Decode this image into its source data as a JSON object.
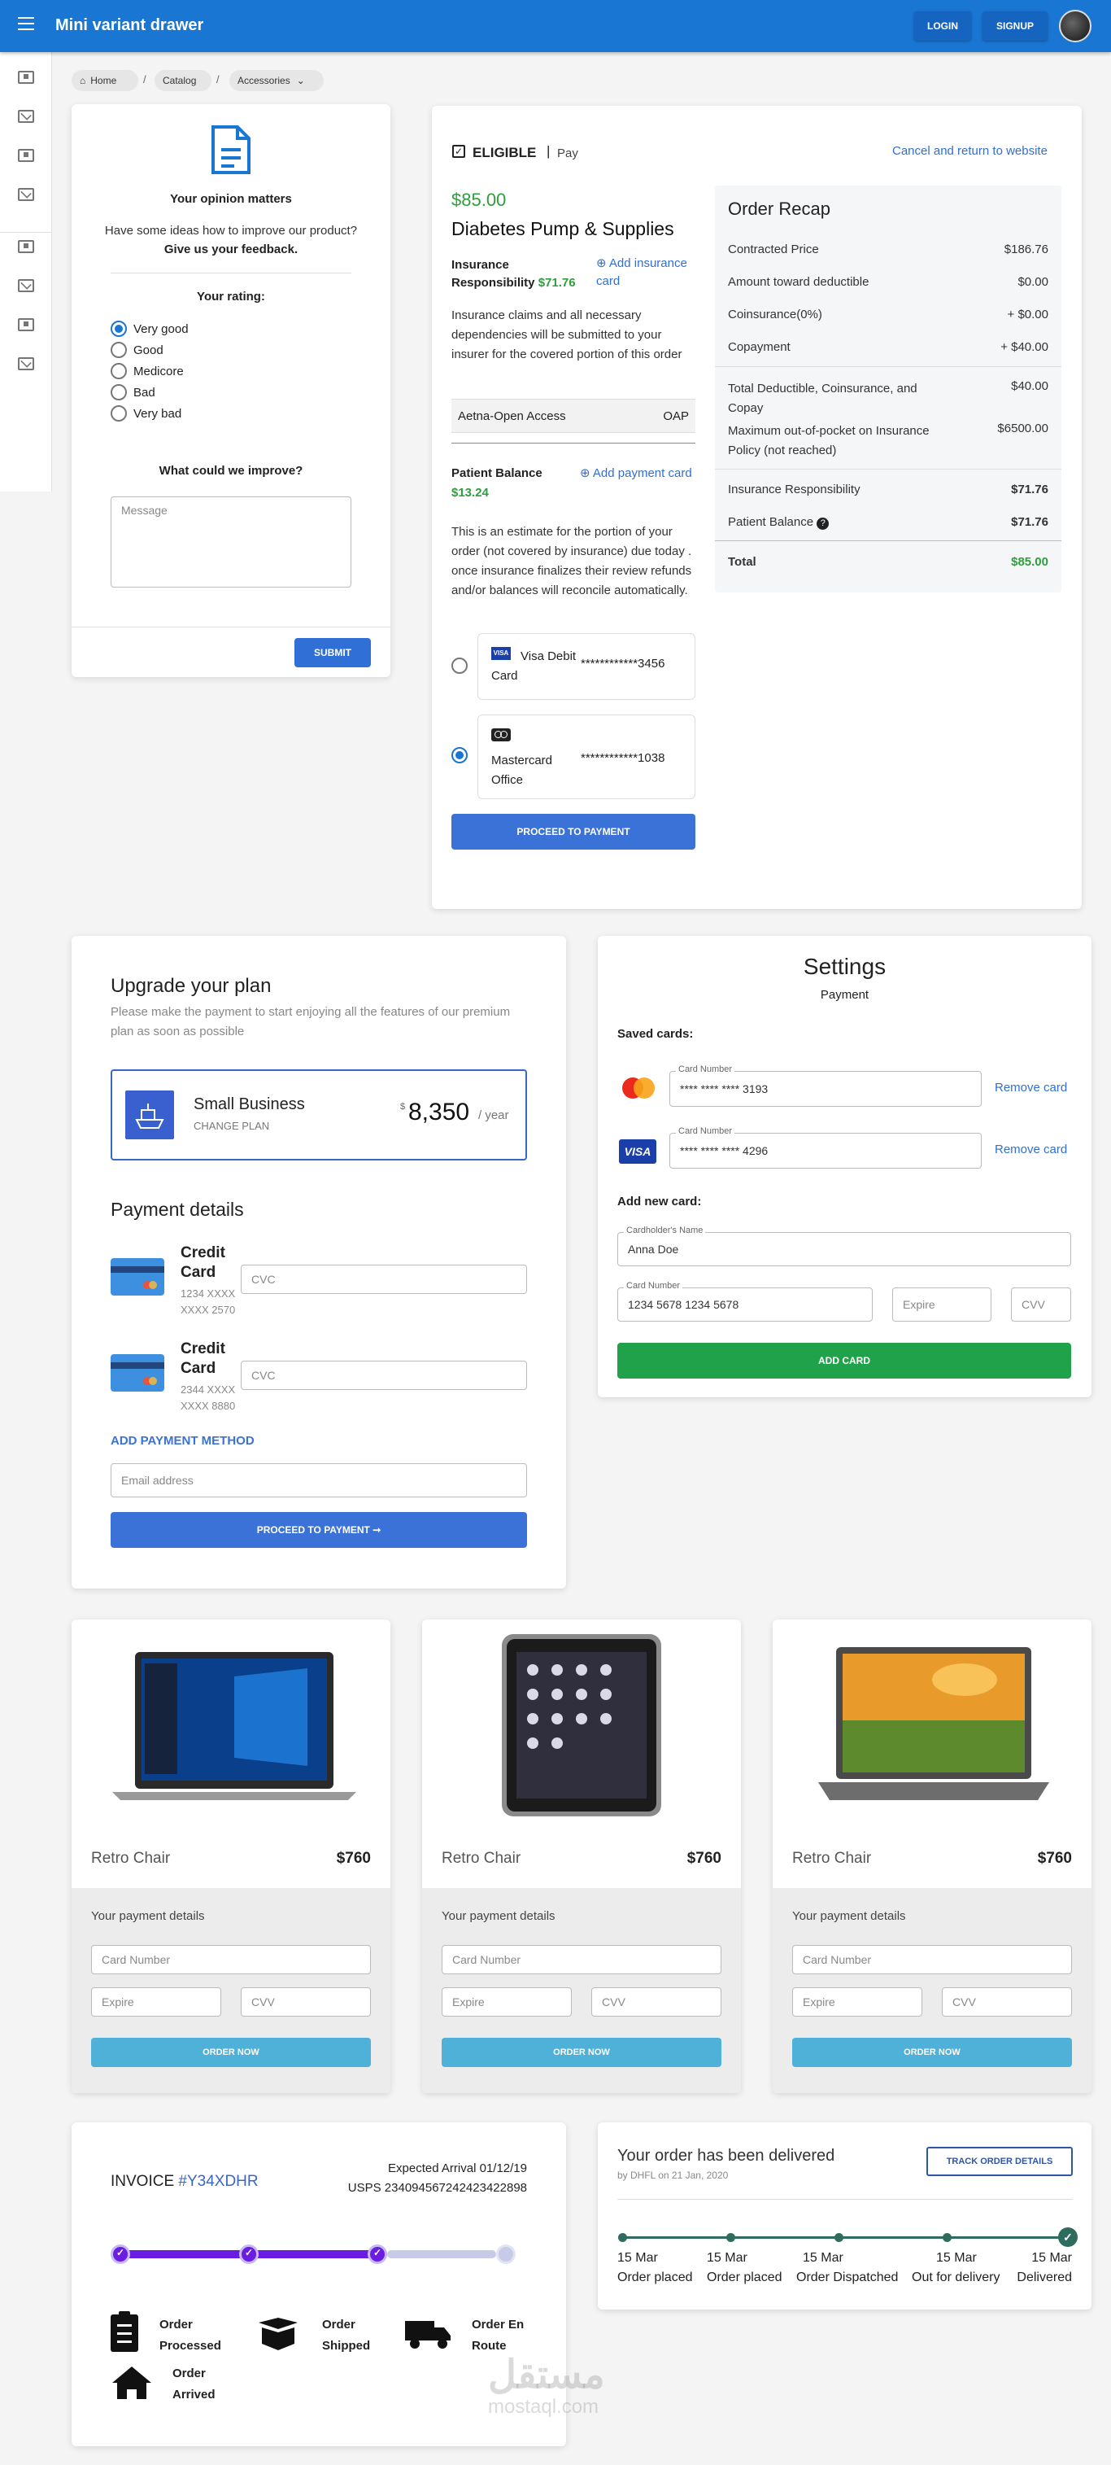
{
  "appbar": {
    "title": "Mini variant drawer",
    "login": "LOGIN",
    "signup": "SIGNUP"
  },
  "breadcrumb": {
    "home": "Home",
    "catalog": "Catalog",
    "accessories": "Accessories"
  },
  "feedback": {
    "title": "Your opinion matters",
    "question": "Have some ideas how to improve our product?",
    "cta": "Give us your feedback.",
    "rating_label": "Your rating:",
    "options": [
      "Very good",
      "Good",
      "Medicore",
      "Bad",
      "Very bad"
    ],
    "improve_label": "What could we improve?",
    "message_placeholder": "Message",
    "submit": "SUBMIT"
  },
  "eligible": {
    "badge": "ELIGIBLE",
    "pay": "Pay",
    "cancel": "Cancel and return to website",
    "price": "$85.00",
    "product": "Diabetes Pump & Supplies",
    "ins_resp_label": "Insurance Responsibility",
    "ins_resp_value": "$71.76",
    "add_insurance": "Add insurance card",
    "claims_text": "Insurance claims and all necessary dependencies will be submitted to your insurer for the covered portion of this order",
    "plan_name": "Aetna-Open Access",
    "plan_code": "OAP",
    "balance_label": "Patient Balance",
    "balance_value": "$13.24",
    "add_payment": "Add payment card",
    "estimate_text": "This is an estimate for the portion of your order (not covered by insurance) due today . once insurance finalizes their review refunds and/or balances will reconcile automatically.",
    "cards": [
      {
        "brand": "VISA",
        "name": "Visa Debit Card",
        "number": "************3456"
      },
      {
        "brand": "MC",
        "name": "Mastercard Office",
        "number": "************1038"
      }
    ],
    "proceed": "PROCEED TO PAYMENT"
  },
  "recap": {
    "title": "Order Recap",
    "rows": [
      {
        "label": "Contracted Price",
        "value": "$186.76"
      },
      {
        "label": "Amount toward deductible",
        "value": "$0.00"
      },
      {
        "label": "Coinsurance(0%)",
        "value": "+ $0.00"
      },
      {
        "label": "Copayment",
        "value": "+ $40.00"
      },
      {
        "label": "Total Deductible, Coinsurance, and Copay",
        "value": "$40.00"
      },
      {
        "label": "Maximum out-of-pocket on Insurance Policy (not reached)",
        "value": "$6500.00"
      },
      {
        "label": "Insurance Responsibility",
        "value": "$71.76"
      },
      {
        "label": "Patient Balance",
        "value": "$71.76"
      },
      {
        "label": "Total",
        "value": "$85.00"
      }
    ]
  },
  "upgrade": {
    "title": "Upgrade your plan",
    "subtitle": "Please make the payment to start enjoying all the features of our premium plan as soon as possible",
    "plan_name": "Small Business",
    "change_plan": "CHANGE PLAN",
    "currency": "$",
    "price": "8,350",
    "period": "/ year",
    "payment_title": "Payment details",
    "cards": [
      {
        "label": "Credit Card",
        "number": "1234 XXXX XXXX 2570",
        "cvc": "CVC"
      },
      {
        "label": "Credit Card",
        "number": "2344 XXXX XXXX 8880",
        "cvc": "CVC"
      }
    ],
    "add_method": "ADD PAYMENT METHOD",
    "email_placeholder": "Email address",
    "proceed": "PROCEED TO PAYMENT ➞"
  },
  "settings": {
    "title": "Settings",
    "subtitle": "Payment",
    "saved_label": "Saved cards:",
    "card_number_label": "Card Number",
    "saved": [
      {
        "number": "**** **** **** 3193",
        "remove": "Remove card"
      },
      {
        "number": "**** **** **** 4296",
        "remove": "Remove card"
      }
    ],
    "add_label": "Add new card:",
    "holder_label": "Cardholder's Name",
    "holder_value": "Anna Doe",
    "new_number": "1234 5678 1234 5678",
    "expire": "Expire",
    "cvv": "CVV",
    "add_card": "ADD CARD"
  },
  "products": [
    {
      "name": "Retro Chair",
      "price": "$760",
      "details": "Your payment details",
      "card_ph": "Card Number",
      "expire_ph": "Expire",
      "cvv_ph": "CVV",
      "order": "ORDER NOW"
    },
    {
      "name": "Retro Chair",
      "price": "$760",
      "details": "Your payment details",
      "card_ph": "Card Number",
      "expire_ph": "Expire",
      "cvv_ph": "CVV",
      "order": "ORDER NOW"
    },
    {
      "name": "Retro Chair",
      "price": "$760",
      "details": "Your payment details",
      "card_ph": "Card Number",
      "expire_ph": "Expire",
      "cvv_ph": "CVV",
      "order": "ORDER NOW"
    }
  ],
  "invoice": {
    "label": "INVOICE",
    "id": "#Y34XDHR",
    "arrival": "Expected Arrival 01/12/19",
    "tracking": "USPS 234094567242423422898",
    "steps": [
      "Order Processed",
      "Order Shipped",
      "Order En Route",
      "Order Arrived"
    ]
  },
  "delivered": {
    "title": "Your order has been delivered",
    "by": "by DHFL on 21 Jan, 2020",
    "track": "TRACK ORDER DETAILS",
    "steps": [
      {
        "date": "15 Mar",
        "label": "Order placed"
      },
      {
        "date": "15 Mar",
        "label": "Order placed"
      },
      {
        "date": "15 Mar",
        "label": "Order Dispatched"
      },
      {
        "date": "15 Mar",
        "label": "Out for delivery"
      },
      {
        "date": "15 Mar",
        "label": "Delivered"
      }
    ]
  },
  "watermark": {
    "arabic": "مستقل",
    "latin": "mostaql.com"
  }
}
